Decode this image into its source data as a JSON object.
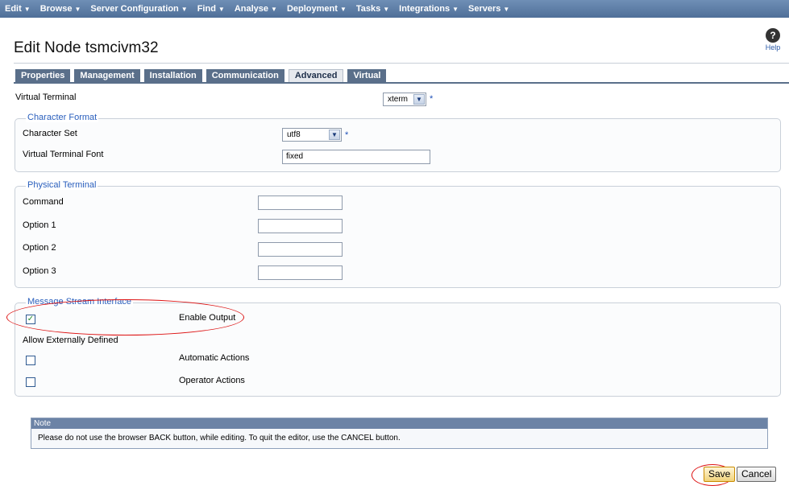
{
  "menu": [
    {
      "label": "Edit"
    },
    {
      "label": "Browse"
    },
    {
      "label": "Server Configuration"
    },
    {
      "label": "Find"
    },
    {
      "label": "Analyse"
    },
    {
      "label": "Deployment"
    },
    {
      "label": "Tasks"
    },
    {
      "label": "Integrations"
    },
    {
      "label": "Servers"
    }
  ],
  "header": {
    "title": "Edit Node tsmcivm32",
    "help_label": "Help",
    "help_icon": "question-icon"
  },
  "tabs": [
    {
      "label": "Properties"
    },
    {
      "label": "Management"
    },
    {
      "label": "Installation"
    },
    {
      "label": "Communication"
    },
    {
      "label": "Advanced",
      "active": true
    },
    {
      "label": "Virtual"
    }
  ],
  "virtual_terminal": {
    "label": "Virtual Terminal",
    "value": "xterm",
    "required": "*"
  },
  "character_format": {
    "legend": "Character Format",
    "charset_label": "Character Set",
    "charset_value": "utf8",
    "charset_required": "*",
    "font_label": "Virtual Terminal Font",
    "font_value": "fixed"
  },
  "physical_terminal": {
    "legend": "Physical Terminal",
    "fields": [
      {
        "label": "Command",
        "value": ""
      },
      {
        "label": "Option 1",
        "value": ""
      },
      {
        "label": "Option 2",
        "value": ""
      },
      {
        "label": "Option 3",
        "value": ""
      }
    ]
  },
  "message_stream": {
    "legend": "Message Stream Interface",
    "enable_output_label": "Enable Output",
    "enable_output_checked": true,
    "allow_label": "Allow Externally Defined",
    "automatic_actions_label": "Automatic Actions",
    "automatic_actions_checked": false,
    "operator_actions_label": "Operator Actions",
    "operator_actions_checked": false
  },
  "note": {
    "heading": "Note",
    "text": "Please do not use the browser BACK button, while editing. To quit the editor, use the CANCEL button."
  },
  "buttons": {
    "save": "Save",
    "cancel": "Cancel"
  },
  "colors": {
    "menu_bar": "#5a7aa3",
    "tab": "#5a6f8a",
    "legend": "#2a5fbd",
    "annotation": "#dd1111"
  }
}
